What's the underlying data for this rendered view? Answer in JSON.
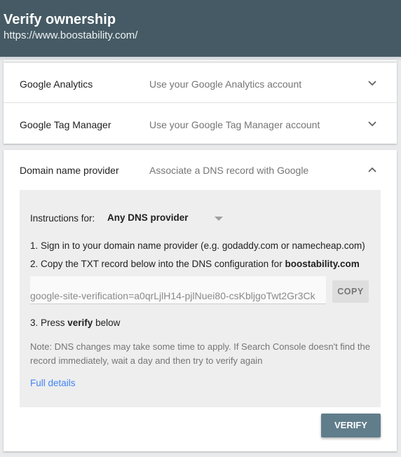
{
  "header": {
    "title": "Verify ownership",
    "url": "https://www.boostability.com/"
  },
  "methods": [
    {
      "name": "Google Analytics",
      "description": "Use your Google Analytics account",
      "expanded": false
    },
    {
      "name": "Google Tag Manager",
      "description": "Use your Google Tag Manager account",
      "expanded": false
    },
    {
      "name": "Domain name provider",
      "description": "Associate a DNS record with Google",
      "expanded": true
    }
  ],
  "dns_panel": {
    "instructions_label": "Instructions for:",
    "provider_selected": "Any DNS provider",
    "step1": "1. Sign in to your domain name provider (e.g. godaddy.com or namecheap.com)",
    "step2_prefix": "2. Copy the TXT record below into the DNS configuration for ",
    "step2_domain": "boostability.com",
    "txt_record": "google-site-verification=a0qrLjlH14-pjlNuei80-csKbljgoTwt2Gr3Ck",
    "copy_label": "COPY",
    "step3_prefix": "3. Press ",
    "step3_bold": "verify",
    "step3_suffix": " below",
    "note": "Note: DNS changes may take some time to apply. If Search Console doesn't find the record immediately, wait a day and then try to verify again",
    "full_details_link": "Full details",
    "verify_label": "VERIFY"
  },
  "colors": {
    "header_bg": "#455a64",
    "verify_button": "#607d8b",
    "link": "#4285f4"
  },
  "icons": {
    "collapsed": "chevron-down-icon",
    "expanded": "chevron-up-icon",
    "dropdown": "dropdown-caret-icon"
  }
}
